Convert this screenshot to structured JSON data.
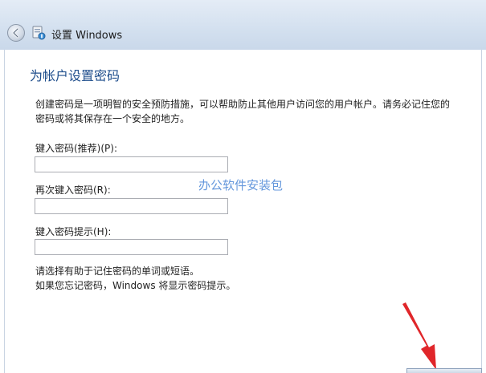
{
  "window": {
    "title": "设置 Windows"
  },
  "page": {
    "heading": "为帐户设置密码",
    "description": "创建密码是一项明智的安全预防措施，可以帮助防止其他用户访问您的用户帐户。请务必记住您的密码或将其保存在一个安全的地方。"
  },
  "fields": {
    "password": {
      "label": "键入密码(推荐)(P):",
      "value": ""
    },
    "confirm": {
      "label": "再次键入密码(R):",
      "value": ""
    },
    "hint": {
      "label": "键入密码提示(H):",
      "value": ""
    }
  },
  "hints": {
    "line1": "请选择有助于记住密码的单词或短语。",
    "line2": "如果您忘记密码，Windows 将显示密码提示。"
  },
  "watermark": "办公软件安装包",
  "colors": {
    "heading": "#1f4e8c",
    "arrow": "#e0262a",
    "watermark": "#4a86d6"
  },
  "icons": [
    "back-arrow-icon",
    "windows-setup-icon",
    "red-arrow-annotation"
  ]
}
